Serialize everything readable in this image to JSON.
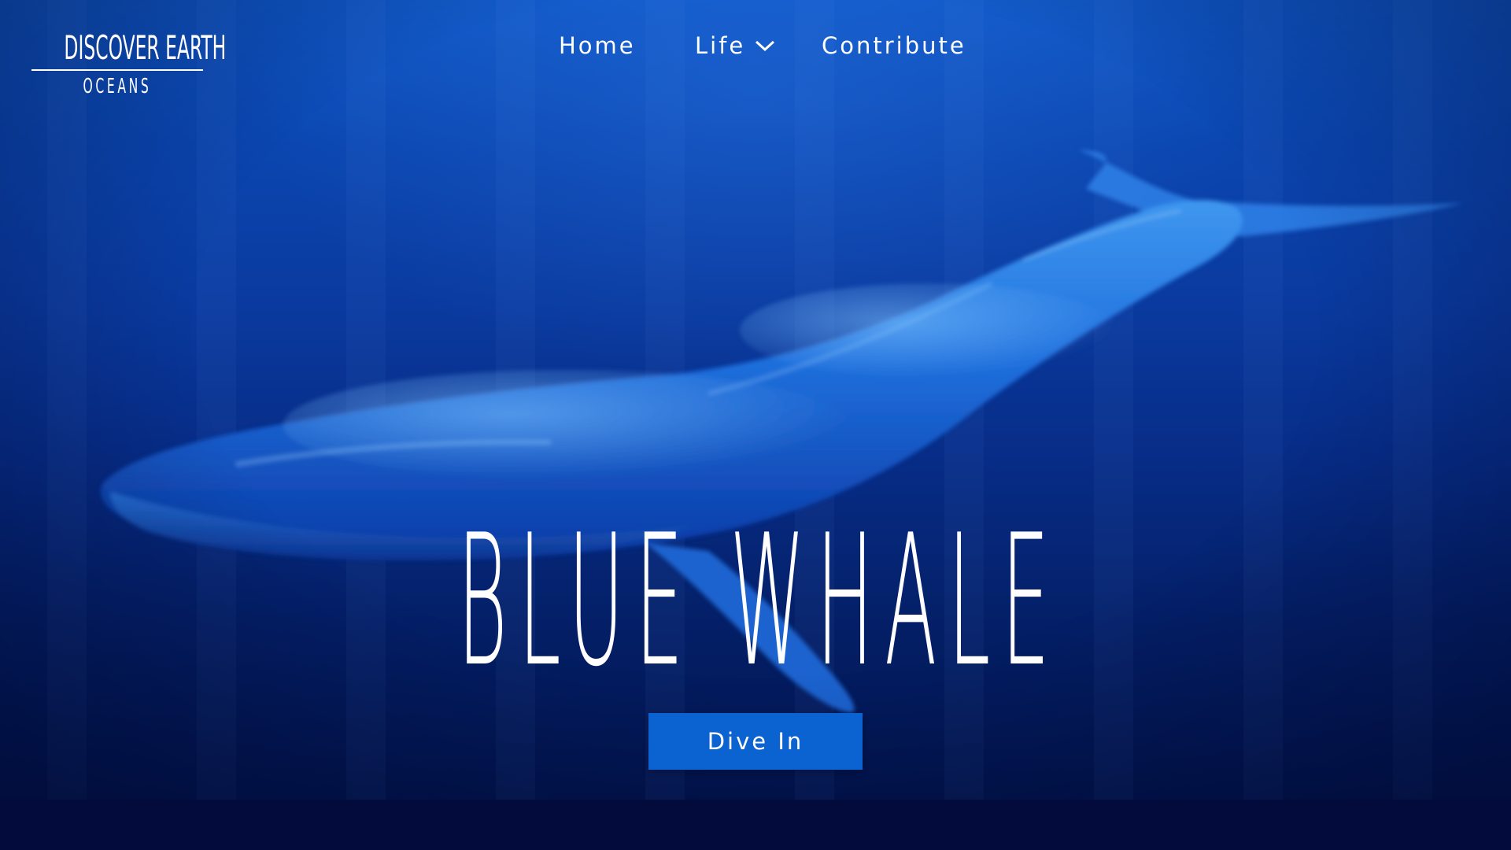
{
  "brand": {
    "title": "DISCOVER EARTH",
    "subtitle": "OCEANS"
  },
  "nav": {
    "items": [
      {
        "label": "Home"
      },
      {
        "label": "Life",
        "has_dropdown": true,
        "icon": "chevron-down-icon"
      },
      {
        "label": "Contribute"
      }
    ]
  },
  "hero": {
    "headline": "BLUE WHALE",
    "cta_label": "Dive In",
    "image": "blue-whale-underwater"
  },
  "colors": {
    "background_top": "#0f56c4",
    "background_bottom": "#02154f",
    "footer_band": "#020b3c",
    "cta": "#0b63d1",
    "text": "#ffffff"
  }
}
